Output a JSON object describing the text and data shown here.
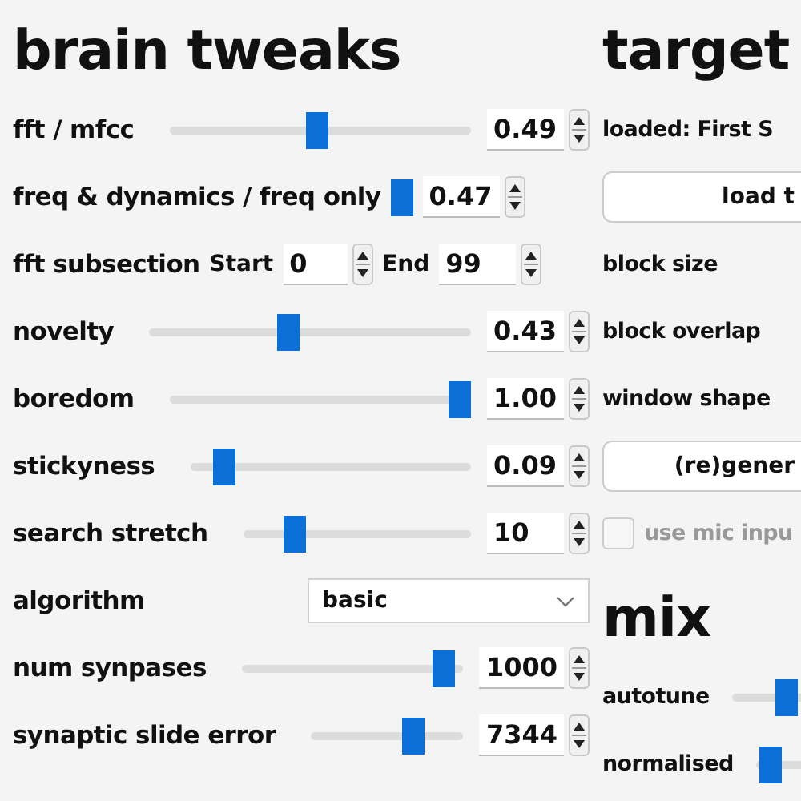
{
  "brain_tweaks": {
    "title": "brain tweaks",
    "rows": [
      {
        "kind": "slider",
        "label": "fft / mfcc",
        "level": 0.49,
        "value": "0.49"
      },
      {
        "kind": "thumb",
        "label": "freq & dynamics / freq only",
        "value": "0.47"
      },
      {
        "kind": "range",
        "label": "fft subsection",
        "start_label": "Start",
        "start": "0",
        "end_label": "End",
        "end": "99"
      },
      {
        "kind": "slider",
        "label": "novelty",
        "level": 0.43,
        "value": "0.43"
      },
      {
        "kind": "slider",
        "label": "boredom",
        "level": 1.0,
        "value": "1.00"
      },
      {
        "kind": "slider",
        "label": "stickyness",
        "level": 0.09,
        "value": "0.09"
      },
      {
        "kind": "slider",
        "label": "search stretch",
        "level": 0.2,
        "value": "10"
      },
      {
        "kind": "dropdown",
        "label": "algorithm",
        "value": "basic"
      },
      {
        "kind": "slider",
        "label": "num synpases",
        "level": 0.96,
        "value": "1000"
      },
      {
        "kind": "slider",
        "label": "synaptic slide error",
        "level": 0.7,
        "value": "7344"
      }
    ]
  },
  "target": {
    "title": "target",
    "rows": [
      {
        "kind": "text",
        "label": "loaded: First S"
      },
      {
        "kind": "button",
        "label": "load t"
      },
      {
        "kind": "label",
        "label": "block size"
      },
      {
        "kind": "label",
        "label": "block overlap"
      },
      {
        "kind": "label",
        "label": "window shape"
      },
      {
        "kind": "button",
        "label": "(re)gener"
      },
      {
        "kind": "checkbox",
        "label": "use mic inpu",
        "checked": false,
        "disabled": true
      }
    ]
  },
  "mix": {
    "title": "mix",
    "rows": [
      {
        "kind": "slider",
        "label": "autotune",
        "level": 0.6
      },
      {
        "kind": "slider",
        "label": "normalised",
        "level": 0.05
      }
    ]
  }
}
